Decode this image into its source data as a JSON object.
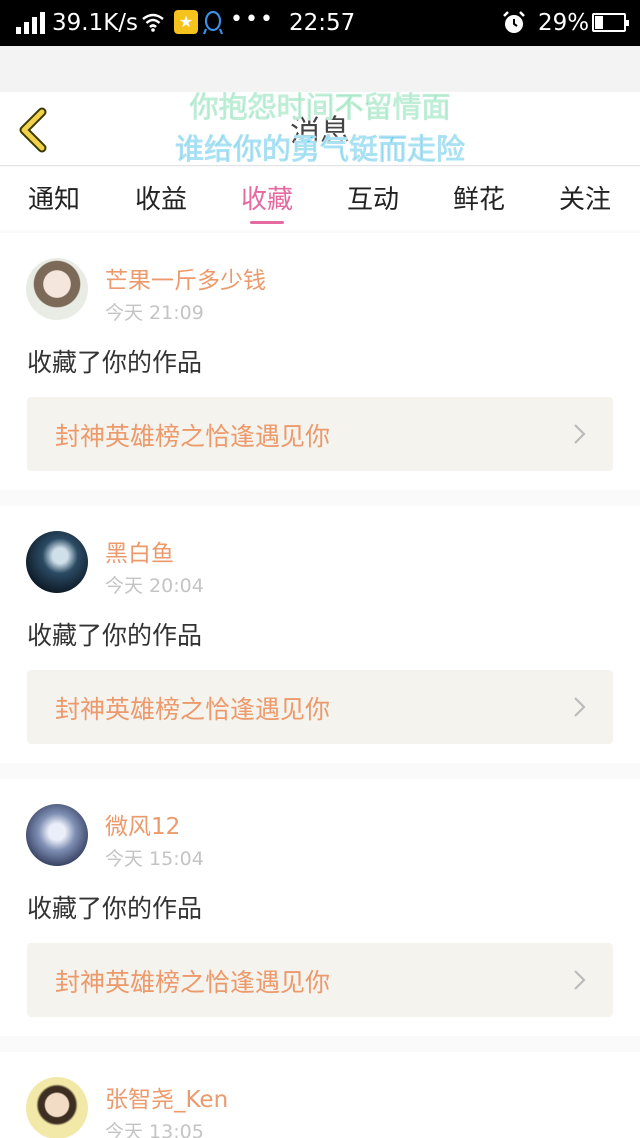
{
  "status_bar": {
    "net_speed": "39.1K/s",
    "time": "22:57",
    "battery": "29%",
    "battery_level": 0.29,
    "icons": [
      "signal-icon",
      "wifi-icon",
      "star-app-icon",
      "qq-icon",
      "more-dots-icon",
      "alarm-icon",
      "battery-icon"
    ]
  },
  "header": {
    "title": "消息",
    "back_icon": "chevron-left-icon",
    "overlay_lines": [
      "你抱怨时间不留情面",
      "谁给你的勇气铤而走险"
    ]
  },
  "tabs": [
    {
      "label": "通知",
      "active": false
    },
    {
      "label": "收益",
      "active": false
    },
    {
      "label": "收藏",
      "active": true
    },
    {
      "label": "互动",
      "active": false
    },
    {
      "label": "鲜花",
      "active": false
    },
    {
      "label": "关注",
      "active": false
    }
  ],
  "items": [
    {
      "user": "芒果一斤多少钱",
      "time": "今天 21:09",
      "action": "收藏了你的作品",
      "work": "封神英雄榜之恰逢遇见你"
    },
    {
      "user": "黑白鱼",
      "time": "今天 20:04",
      "action": "收藏了你的作品",
      "work": "封神英雄榜之恰逢遇见你"
    },
    {
      "user": "微风12",
      "time": "今天 15:04",
      "action": "收藏了你的作品",
      "work": "封神英雄榜之恰逢遇见你"
    },
    {
      "user": "张智尧_Ken",
      "time": "今天 13:05",
      "action": "",
      "work": ""
    }
  ],
  "colors": {
    "accent": "#e46aa1",
    "username": "#ec9a6c",
    "card_link_bg": "#f4f3ed",
    "overlay_green": "#61d49c",
    "overlay_blue": "#2bb4e2"
  }
}
